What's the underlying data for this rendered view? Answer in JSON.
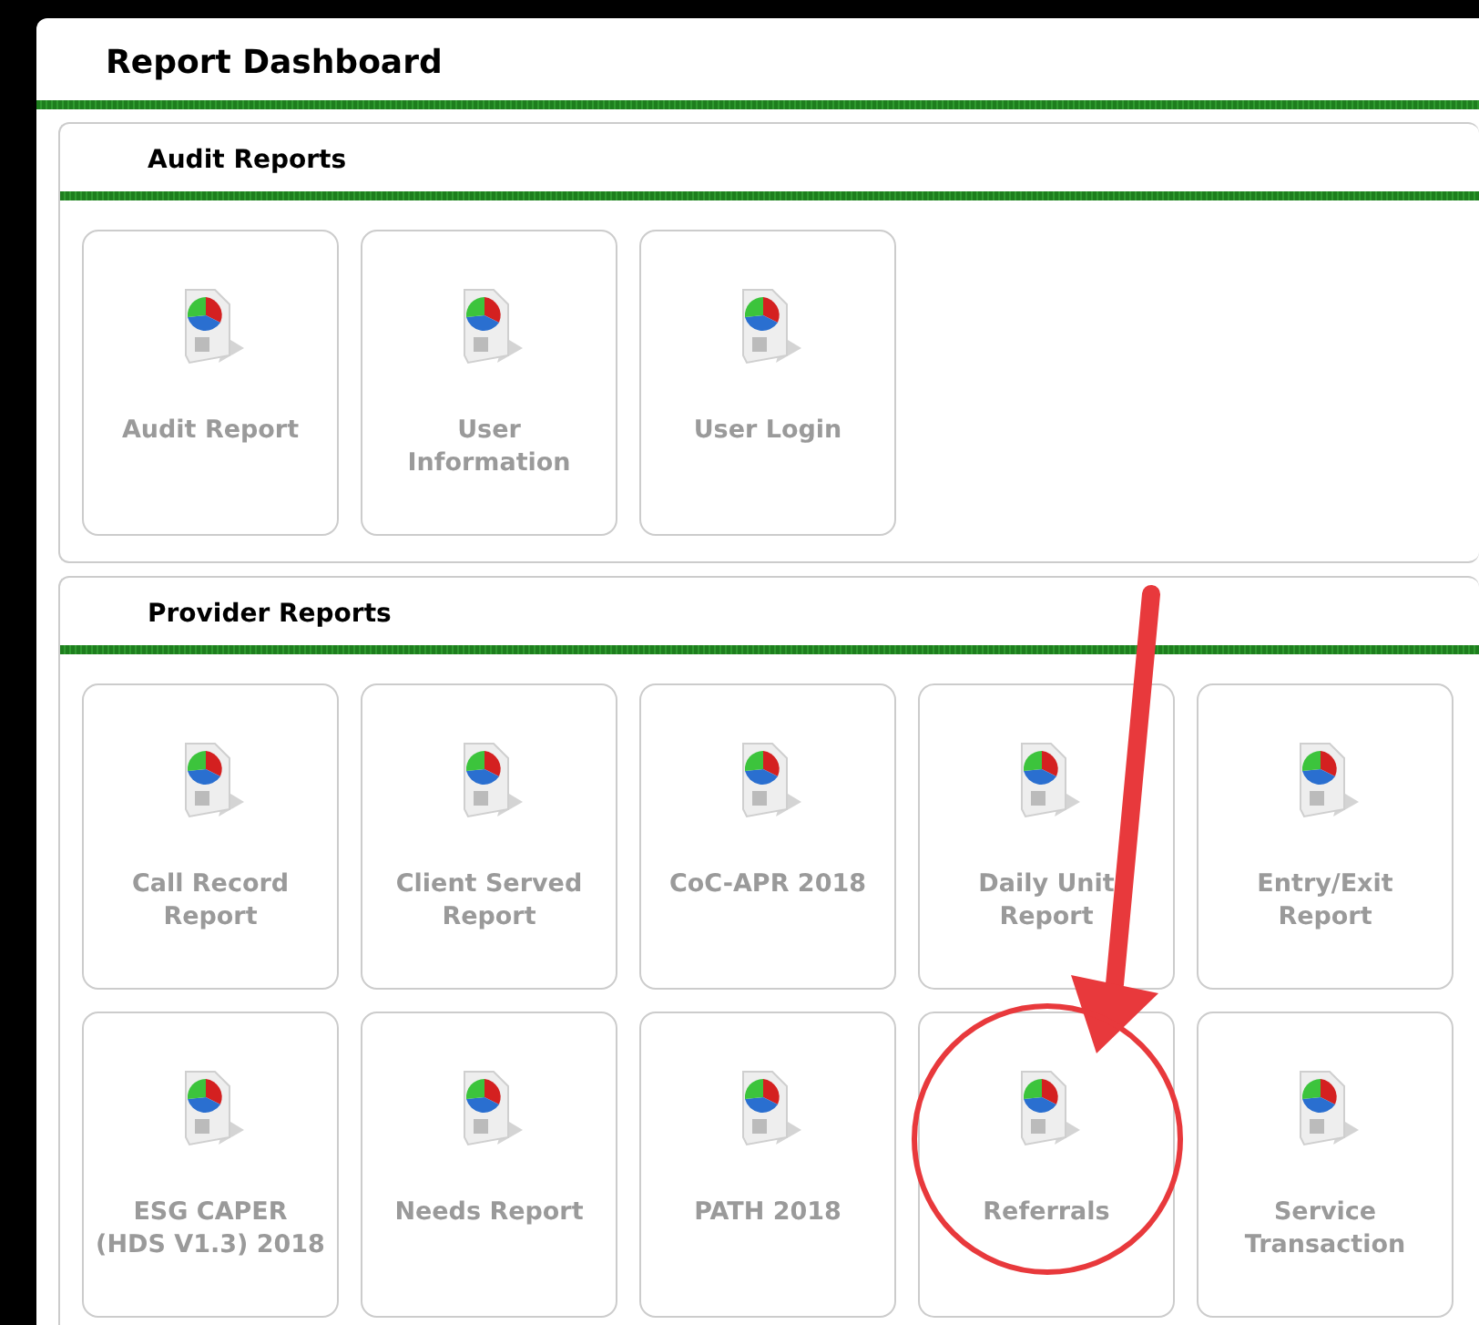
{
  "page": {
    "title": "Report Dashboard"
  },
  "sections": [
    {
      "title": "Audit Reports",
      "tiles": [
        {
          "label": "Audit Report"
        },
        {
          "label": "User Information"
        },
        {
          "label": "User Login"
        }
      ]
    },
    {
      "title": "Provider Reports",
      "tiles": [
        {
          "label": "Call Record Report"
        },
        {
          "label": "Client Served Report"
        },
        {
          "label": "CoC-APR 2018"
        },
        {
          "label": "Daily Unit Report"
        },
        {
          "label": "Entry/Exit Report"
        },
        {
          "label": "ESG CAPER (HDS V1.3) 2018"
        },
        {
          "label": "Needs Report"
        },
        {
          "label": "PATH 2018"
        },
        {
          "label": "Referrals"
        },
        {
          "label": "Service Transaction"
        }
      ]
    }
  ],
  "annotations": {
    "arrow": true,
    "circle": true
  }
}
